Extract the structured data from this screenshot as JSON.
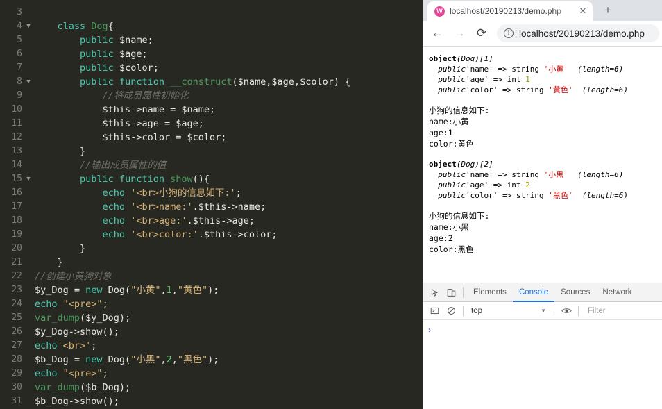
{
  "editor": {
    "language": "php",
    "theme_bg": "#272822",
    "lines": [
      {
        "num": "",
        "fold": false,
        "partial": true,
        "tokens": []
      },
      {
        "num": "3",
        "fold": false,
        "tokens": []
      },
      {
        "num": "4",
        "fold": true,
        "indent": 4,
        "tokens": [
          {
            "t": "class",
            "c": "kw"
          },
          {
            "t": " ",
            "c": "punc"
          },
          {
            "t": "Dog",
            "c": "cls"
          },
          {
            "t": "{",
            "c": "punc"
          }
        ]
      },
      {
        "num": "5",
        "fold": false,
        "indent": 8,
        "tokens": [
          {
            "t": "public",
            "c": "kw"
          },
          {
            "t": " $name;",
            "c": "punc"
          }
        ]
      },
      {
        "num": "6",
        "fold": false,
        "indent": 8,
        "tokens": [
          {
            "t": "public",
            "c": "kw"
          },
          {
            "t": " $age;",
            "c": "punc"
          }
        ]
      },
      {
        "num": "7",
        "fold": false,
        "indent": 8,
        "tokens": [
          {
            "t": "public",
            "c": "kw"
          },
          {
            "t": " $color;",
            "c": "punc"
          }
        ]
      },
      {
        "num": "8",
        "fold": true,
        "indent": 8,
        "tokens": [
          {
            "t": "public",
            "c": "kw"
          },
          {
            "t": " ",
            "c": "punc"
          },
          {
            "t": "function",
            "c": "kw"
          },
          {
            "t": " ",
            "c": "punc"
          },
          {
            "t": "__construct",
            "c": "cls"
          },
          {
            "t": "($name,$age,$color) {",
            "c": "punc"
          }
        ]
      },
      {
        "num": "9",
        "fold": false,
        "indent": 12,
        "tokens": [
          {
            "t": "//将成员属性初始化",
            "c": "cmt"
          }
        ]
      },
      {
        "num": "10",
        "fold": false,
        "indent": 12,
        "tokens": [
          {
            "t": "$this->name = $name;",
            "c": "punc"
          }
        ]
      },
      {
        "num": "11",
        "fold": false,
        "indent": 12,
        "tokens": [
          {
            "t": "$this->age = $age;",
            "c": "punc"
          }
        ]
      },
      {
        "num": "12",
        "fold": false,
        "indent": 12,
        "tokens": [
          {
            "t": "$this->color = $color;",
            "c": "punc"
          }
        ]
      },
      {
        "num": "13",
        "fold": false,
        "indent": 8,
        "tokens": [
          {
            "t": "}",
            "c": "punc"
          }
        ]
      },
      {
        "num": "14",
        "fold": false,
        "indent": 8,
        "tokens": [
          {
            "t": "//输出成员属性的值",
            "c": "cmt"
          }
        ]
      },
      {
        "num": "15",
        "fold": true,
        "indent": 8,
        "tokens": [
          {
            "t": "public",
            "c": "kw"
          },
          {
            "t": " ",
            "c": "punc"
          },
          {
            "t": "function",
            "c": "kw"
          },
          {
            "t": " ",
            "c": "punc"
          },
          {
            "t": "show",
            "c": "cls"
          },
          {
            "t": "(){",
            "c": "punc"
          }
        ]
      },
      {
        "num": "16",
        "fold": false,
        "indent": 12,
        "tokens": [
          {
            "t": "echo",
            "c": "kw"
          },
          {
            "t": " ",
            "c": "punc"
          },
          {
            "t": "'<br>小狗的信息如下:'",
            "c": "str"
          },
          {
            "t": ";",
            "c": "punc"
          }
        ]
      },
      {
        "num": "17",
        "fold": false,
        "indent": 12,
        "tokens": [
          {
            "t": "echo",
            "c": "kw"
          },
          {
            "t": " ",
            "c": "punc"
          },
          {
            "t": "'<br>name:'",
            "c": "str"
          },
          {
            "t": ".$this->name;",
            "c": "punc"
          }
        ]
      },
      {
        "num": "18",
        "fold": false,
        "indent": 12,
        "tokens": [
          {
            "t": "echo",
            "c": "kw"
          },
          {
            "t": " ",
            "c": "punc"
          },
          {
            "t": "'<br>age:'",
            "c": "str"
          },
          {
            "t": ".$this->age;",
            "c": "punc"
          }
        ]
      },
      {
        "num": "19",
        "fold": false,
        "indent": 12,
        "tokens": [
          {
            "t": "echo",
            "c": "kw"
          },
          {
            "t": " ",
            "c": "punc"
          },
          {
            "t": "'<br>color:'",
            "c": "str"
          },
          {
            "t": ".$this->color;",
            "c": "punc"
          }
        ]
      },
      {
        "num": "20",
        "fold": false,
        "indent": 8,
        "tokens": [
          {
            "t": "}",
            "c": "punc"
          }
        ]
      },
      {
        "num": "21",
        "fold": false,
        "indent": 4,
        "tokens": [
          {
            "t": "}",
            "c": "punc"
          }
        ]
      },
      {
        "num": "22",
        "fold": false,
        "indent": 0,
        "tokens": [
          {
            "t": "//创建小黄狗对象",
            "c": "cmt"
          }
        ]
      },
      {
        "num": "23",
        "fold": false,
        "indent": 0,
        "tokens": [
          {
            "t": "$y_Dog = ",
            "c": "punc"
          },
          {
            "t": "new",
            "c": "kw"
          },
          {
            "t": " Dog(",
            "c": "punc"
          },
          {
            "t": "\"小黄\"",
            "c": "str"
          },
          {
            "t": ",",
            "c": "punc"
          },
          {
            "t": "1",
            "c": "num"
          },
          {
            "t": ",",
            "c": "punc"
          },
          {
            "t": "\"黄色\"",
            "c": "str"
          },
          {
            "t": ");",
            "c": "punc"
          }
        ]
      },
      {
        "num": "24",
        "fold": false,
        "indent": 0,
        "tokens": [
          {
            "t": "echo",
            "c": "kw"
          },
          {
            "t": " ",
            "c": "punc"
          },
          {
            "t": "\"<pre>\"",
            "c": "str"
          },
          {
            "t": ";",
            "c": "punc"
          }
        ]
      },
      {
        "num": "25",
        "fold": false,
        "indent": 0,
        "tokens": [
          {
            "t": "var_dump",
            "c": "grn"
          },
          {
            "t": "($y_Dog);",
            "c": "punc"
          }
        ]
      },
      {
        "num": "26",
        "fold": false,
        "indent": 0,
        "tokens": [
          {
            "t": "$y_Dog->show();",
            "c": "punc"
          }
        ]
      },
      {
        "num": "27",
        "fold": false,
        "indent": 0,
        "tokens": [
          {
            "t": "echo",
            "c": "kw"
          },
          {
            "t": "'<br>'",
            "c": "str"
          },
          {
            "t": ";",
            "c": "punc"
          }
        ]
      },
      {
        "num": "28",
        "fold": false,
        "indent": 0,
        "tokens": [
          {
            "t": "$b_Dog = ",
            "c": "punc"
          },
          {
            "t": "new",
            "c": "kw"
          },
          {
            "t": " Dog(",
            "c": "punc"
          },
          {
            "t": "\"小黑\"",
            "c": "str"
          },
          {
            "t": ",",
            "c": "punc"
          },
          {
            "t": "2",
            "c": "num"
          },
          {
            "t": ",",
            "c": "punc"
          },
          {
            "t": "\"黑色\"",
            "c": "str"
          },
          {
            "t": ");",
            "c": "punc"
          }
        ]
      },
      {
        "num": "29",
        "fold": false,
        "indent": 0,
        "tokens": [
          {
            "t": "echo",
            "c": "kw"
          },
          {
            "t": " ",
            "c": "punc"
          },
          {
            "t": "\"<pre>\"",
            "c": "str"
          },
          {
            "t": ";",
            "c": "punc"
          }
        ]
      },
      {
        "num": "30",
        "fold": false,
        "indent": 0,
        "tokens": [
          {
            "t": "var_dump",
            "c": "grn"
          },
          {
            "t": "($b_Dog);",
            "c": "punc"
          }
        ]
      },
      {
        "num": "31",
        "fold": false,
        "indent": 0,
        "tokens": [
          {
            "t": "$b_Dog->show();",
            "c": "punc"
          }
        ]
      }
    ]
  },
  "browser": {
    "tab": {
      "favicon_letter": "W",
      "favicon_color": "#e8499a",
      "title": "localhost/20190213/demo.php",
      "close_label": "✕"
    },
    "new_tab_label": "+",
    "toolbar": {
      "back_label": "←",
      "forward_label": "→",
      "reload_label": "⟳",
      "info_label": "i",
      "url_scheme": "",
      "url": "localhost/20190213/demo.php"
    },
    "page": {
      "dumps": [
        {
          "header_kw": "object",
          "header_class": "(Dog)",
          "header_id": "[1]",
          "props": [
            {
              "vis": "public",
              "name": "'name'",
              "arrow": "=>",
              "type": "string",
              "value": "'小黄'",
              "meta": "(length=6)",
              "value_color": "red"
            },
            {
              "vis": "public",
              "name": "'age'",
              "arrow": "=>",
              "type": "int",
              "value": "1",
              "meta": "",
              "value_color": "olive"
            },
            {
              "vis": "public",
              "name": "'color'",
              "arrow": "=>",
              "type": "string",
              "value": "'黄色'",
              "meta": "(length=6)",
              "value_color": "red"
            }
          ]
        },
        {
          "header_kw": "object",
          "header_class": "(Dog)",
          "header_id": "[2]",
          "props": [
            {
              "vis": "public",
              "name": "'name'",
              "arrow": "=>",
              "type": "string",
              "value": "'小黑'",
              "meta": "(length=6)",
              "value_color": "red"
            },
            {
              "vis": "public",
              "name": "'age'",
              "arrow": "=>",
              "type": "int",
              "value": "2",
              "meta": "",
              "value_color": "olive"
            },
            {
              "vis": "public",
              "name": "'color'",
              "arrow": "=>",
              "type": "string",
              "value": "'黑色'",
              "meta": "(length=6)",
              "value_color": "red"
            }
          ]
        }
      ],
      "show_blocks": [
        {
          "title": "小狗的信息如下:",
          "name": "name:小黄",
          "age": "age:1",
          "color": "color:黄色"
        },
        {
          "title": "小狗的信息如下:",
          "name": "name:小黑",
          "age": "age:2",
          "color": "color:黑色"
        }
      ]
    }
  },
  "devtools": {
    "inspect_icon": "inspect",
    "device_icon": "device",
    "tabs": [
      {
        "label": "Elements",
        "selected": false
      },
      {
        "label": "Console",
        "selected": true
      },
      {
        "label": "Sources",
        "selected": false
      },
      {
        "label": "Network",
        "selected": false
      }
    ],
    "filterbar": {
      "execute_label": "▷",
      "clear_label": "⊘",
      "context": "top",
      "caret": "▼",
      "eye_label": "◉",
      "filter_placeholder": "Filter"
    },
    "console": {
      "prompt": "›"
    }
  }
}
